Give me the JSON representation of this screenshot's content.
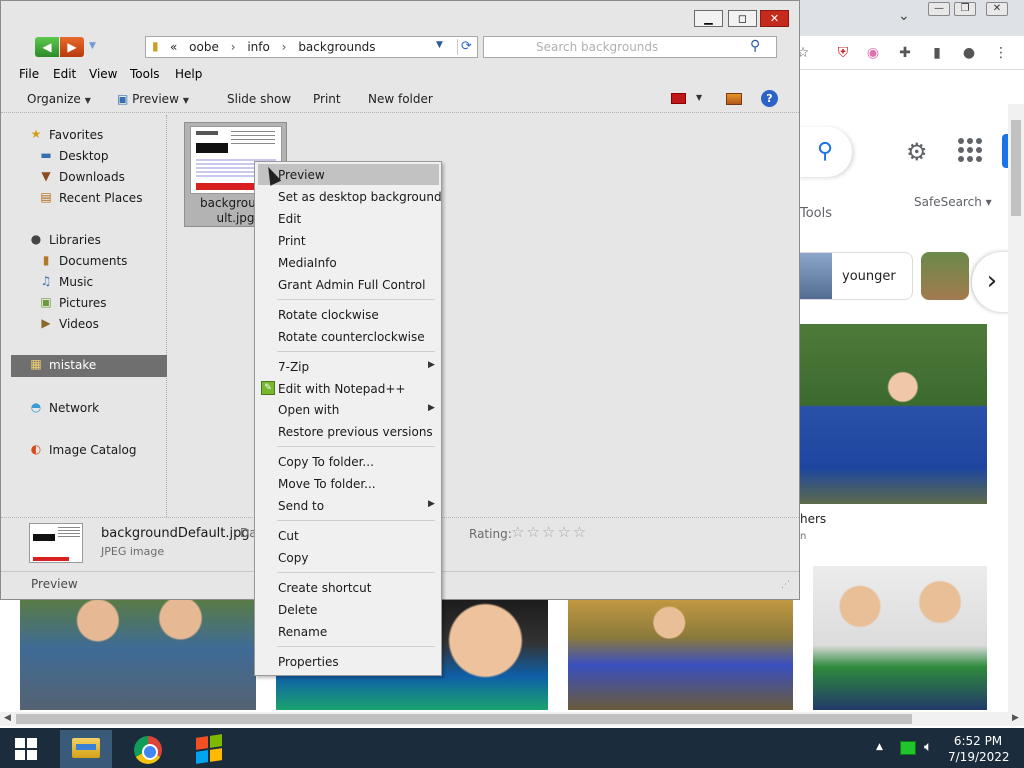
{
  "browser": {
    "window_controls": {
      "minimize": "—",
      "maximize": "❐",
      "close": "✕"
    },
    "tools_label": "Tools",
    "safesearch_label": "SafeSearch",
    "chip_label": "younger",
    "caption_line1": "hers",
    "caption_line2": "n"
  },
  "explorer": {
    "address": {
      "overflow": "«",
      "crumbs": [
        "oobe",
        "info",
        "backgrounds"
      ]
    },
    "search_placeholder": "Search backgrounds",
    "menu": [
      "File",
      "Edit",
      "View",
      "Tools",
      "Help"
    ],
    "toolbar": {
      "organize": "Organize",
      "preview": "Preview",
      "slideshow": "Slide show",
      "print": "Print",
      "new_folder": "New folder"
    },
    "nav": {
      "favorites": "Favorites",
      "desktop": "Desktop",
      "downloads": "Downloads",
      "recent_places": "Recent Places",
      "libraries": "Libraries",
      "documents": "Documents",
      "music": "Music",
      "pictures": "Pictures",
      "videos": "Videos",
      "homegroup": "mistake",
      "network": "Network",
      "image_catalog": "Image Catalog"
    },
    "file": {
      "name_line1": "background",
      "name_line2": "ult.jpg"
    },
    "details": {
      "name": "backgroundDefault.jpg",
      "date_label": "Da",
      "type": "JPEG image",
      "rating_label": "Rating:",
      "stars": "☆☆☆☆☆"
    },
    "status": "Preview"
  },
  "context_menu": {
    "preview": "Preview",
    "set_desktop": "Set as desktop background",
    "edit": "Edit",
    "print": "Print",
    "mediainfo": "MediaInfo",
    "grant_admin": "Grant Admin Full Control",
    "rotate_cw": "Rotate clockwise",
    "rotate_ccw": "Rotate counterclockwise",
    "zip": "7-Zip",
    "notepad": "Edit with Notepad++",
    "open_with": "Open with",
    "restore": "Restore previous versions",
    "copy_to": "Copy To folder...",
    "move_to": "Move To folder...",
    "send_to": "Send to",
    "cut": "Cut",
    "copy": "Copy",
    "create_shortcut": "Create shortcut",
    "delete": "Delete",
    "rename": "Rename",
    "properties": "Properties"
  },
  "taskbar": {
    "time": "6:52 PM",
    "date": "7/19/2022"
  }
}
